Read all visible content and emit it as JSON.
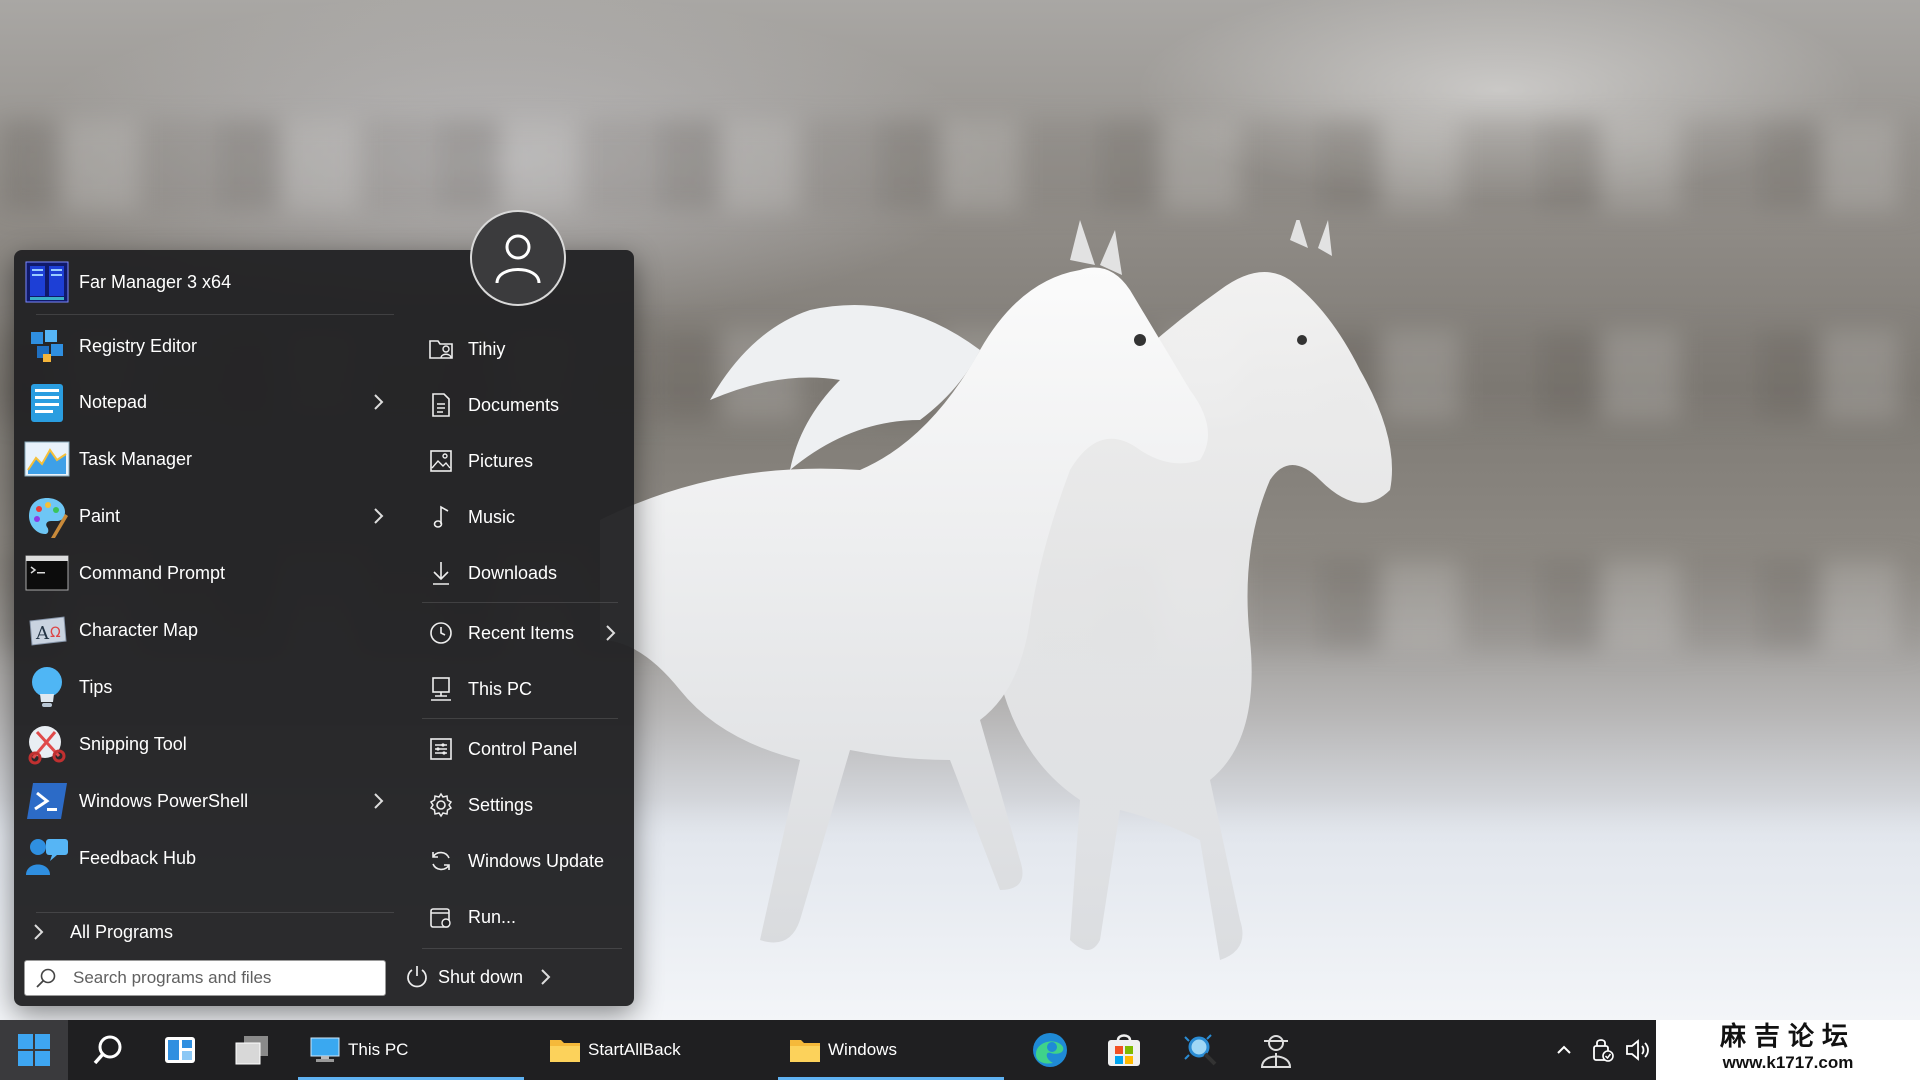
{
  "start_menu": {
    "programs": [
      {
        "label": "Far Manager 3 x64",
        "icon": "far-manager-icon",
        "submenu": false
      },
      {
        "label": "Registry Editor",
        "icon": "registry-editor-icon",
        "submenu": false
      },
      {
        "label": "Notepad",
        "icon": "notepad-icon",
        "submenu": true
      },
      {
        "label": "Task Manager",
        "icon": "task-manager-icon",
        "submenu": false
      },
      {
        "label": "Paint",
        "icon": "paint-icon",
        "submenu": true
      },
      {
        "label": "Command Prompt",
        "icon": "command-prompt-icon",
        "submenu": false
      },
      {
        "label": "Character Map",
        "icon": "character-map-icon",
        "submenu": false
      },
      {
        "label": "Tips",
        "icon": "tips-icon",
        "submenu": false
      },
      {
        "label": "Snipping Tool",
        "icon": "snipping-tool-icon",
        "submenu": false
      },
      {
        "label": "Windows PowerShell",
        "icon": "powershell-icon",
        "submenu": true
      },
      {
        "label": "Feedback Hub",
        "icon": "feedback-hub-icon",
        "submenu": false
      }
    ],
    "all_programs_label": "All Programs",
    "search_placeholder": "Search programs and files",
    "places": [
      {
        "label": "Tihiy",
        "icon": "user-folder-icon",
        "submenu": false
      },
      {
        "label": "Documents",
        "icon": "documents-icon",
        "submenu": false
      },
      {
        "label": "Pictures",
        "icon": "pictures-icon",
        "submenu": false
      },
      {
        "label": "Music",
        "icon": "music-icon",
        "submenu": false
      },
      {
        "label": "Downloads",
        "icon": "downloads-icon",
        "submenu": false
      },
      {
        "label": "Recent Items",
        "icon": "clock-icon",
        "submenu": true
      },
      {
        "label": "This PC",
        "icon": "computer-icon",
        "submenu": false
      },
      {
        "label": "Control Panel",
        "icon": "control-panel-icon",
        "submenu": false
      },
      {
        "label": "Settings",
        "icon": "gear-icon",
        "submenu": false
      },
      {
        "label": "Windows Update",
        "icon": "refresh-icon",
        "submenu": false
      },
      {
        "label": "Run...",
        "icon": "run-icon",
        "submenu": false
      }
    ],
    "shutdown_label": "Shut down"
  },
  "taskbar": {
    "apps": [
      {
        "label": "This PC",
        "icon": "computer-icon"
      },
      {
        "label": "StartAllBack",
        "icon": "folder-icon"
      },
      {
        "label": "Windows",
        "icon": "folder-icon"
      }
    ],
    "pinned": [
      "edge-icon",
      "store-icon",
      "magnifier-icon",
      "agent-icon"
    ],
    "tray": [
      "chevron-up-icon",
      "security-icon",
      "volume-icon"
    ]
  },
  "watermark": {
    "line1": "麻吉论坛",
    "line2": "www.k1717.com"
  },
  "colors": {
    "menu_bg": "#222224",
    "taskbar_bg": "#1f1f21",
    "accent": "#5fb2f2"
  }
}
